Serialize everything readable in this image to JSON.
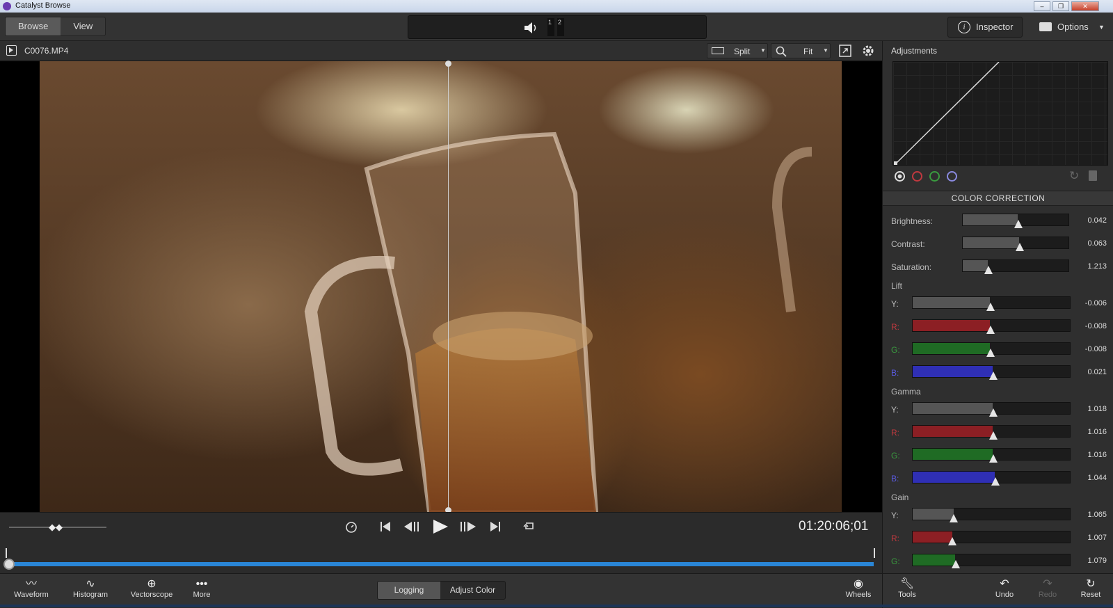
{
  "window": {
    "title": "Catalyst Browse",
    "controls": [
      "–",
      "❐",
      "✕"
    ]
  },
  "topbar": {
    "tabs": [
      "Browse",
      "View"
    ],
    "audio_channels": [
      "1",
      "2"
    ],
    "inspector_label": "Inspector",
    "options_label": "Options"
  },
  "filebar": {
    "filename": "C0076.MP4",
    "split_label": "Split",
    "fit_label": "Fit"
  },
  "panel": {
    "title": "Adjustments",
    "section_title": "COLOR CORRECTION",
    "basic": [
      {
        "label": "Brightness:",
        "value": "0.042",
        "pos": 0.52
      },
      {
        "label": "Contrast:",
        "value": "0.063",
        "pos": 0.53
      },
      {
        "label": "Saturation:",
        "value": "1.213",
        "pos": 0.24
      }
    ],
    "groups": [
      {
        "name": "Lift",
        "rows": [
          {
            "label": "Y:",
            "value": "-0.006",
            "pos": 0.49,
            "color": "#555555"
          },
          {
            "label": "R:",
            "value": "-0.008",
            "pos": 0.49,
            "color": "#8c1f24"
          },
          {
            "label": "G:",
            "value": "-0.008",
            "pos": 0.49,
            "color": "#1f6b24"
          },
          {
            "label": "B:",
            "value": "0.021",
            "pos": 0.51,
            "color": "#2f2fb5"
          }
        ]
      },
      {
        "name": "Gamma",
        "rows": [
          {
            "label": "Y:",
            "value": "1.018",
            "pos": 0.51,
            "color": "#555555"
          },
          {
            "label": "R:",
            "value": "1.016",
            "pos": 0.51,
            "color": "#8c1f24"
          },
          {
            "label": "G:",
            "value": "1.016",
            "pos": 0.51,
            "color": "#1f6b24"
          },
          {
            "label": "B:",
            "value": "1.044",
            "pos": 0.52,
            "color": "#2f2fb5"
          }
        ]
      },
      {
        "name": "Gain",
        "rows": [
          {
            "label": "Y:",
            "value": "1.065",
            "pos": 0.26,
            "color": "#555555"
          },
          {
            "label": "R:",
            "value": "1.007",
            "pos": 0.25,
            "color": "#8c1f24"
          },
          {
            "label": "G:",
            "value": "1.079",
            "pos": 0.27,
            "color": "#1f6b24"
          }
        ]
      }
    ],
    "label_colors": {
      "Y:": "#bbbbbb",
      "R:": "#c0393f",
      "G:": "#3a9a3f",
      "B:": "#5a5ae0"
    }
  },
  "transport": {
    "timecode": "01:20:06;01"
  },
  "bottombar": {
    "left_tools": [
      "Waveform",
      "Histogram",
      "Vectorscope",
      "More"
    ],
    "modes": [
      "Logging",
      "Adjust Color"
    ],
    "wheels_label": "Wheels",
    "right_tools": [
      "Tools",
      "Undo",
      "Redo",
      "Reset"
    ]
  }
}
